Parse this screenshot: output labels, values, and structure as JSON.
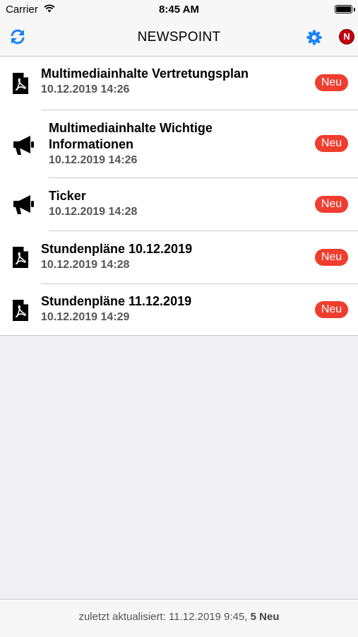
{
  "status_bar": {
    "carrier": "Carrier",
    "time": "8:45 AM"
  },
  "nav": {
    "title": "NEWSPOINT",
    "profile_initial": "N"
  },
  "items": [
    {
      "title_lines": [
        "Multimediainhalte Vertretungsplan"
      ],
      "date": "10.12.2019 14:26",
      "icon": "pdf-icon",
      "badge": "Neu"
    },
    {
      "title_lines": [
        "Multimediainhalte Wichtige",
        "Informationen"
      ],
      "date": "10.12.2019 14:26",
      "icon": "megaphone-icon",
      "badge": "Neu"
    },
    {
      "title_lines": [
        "Ticker"
      ],
      "date": "10.12.2019 14:28",
      "icon": "megaphone-icon",
      "badge": "Neu"
    },
    {
      "title_lines": [
        "Stundenpläne 10.12.2019"
      ],
      "date": "10.12.2019 14:28",
      "icon": "pdf-icon",
      "badge": "Neu"
    },
    {
      "title_lines": [
        "Stundenpläne 11.12.2019"
      ],
      "date": "10.12.2019 14:29",
      "icon": "pdf-icon",
      "badge": "Neu"
    }
  ],
  "footer": {
    "updated_label": "zuletzt aktualisiert: 11.12.2019 9:45,",
    "new_count": "5 Neu"
  },
  "colors": {
    "accent": "#1a82fb",
    "badge": "#ef3d2f",
    "profile": "#c00010"
  }
}
